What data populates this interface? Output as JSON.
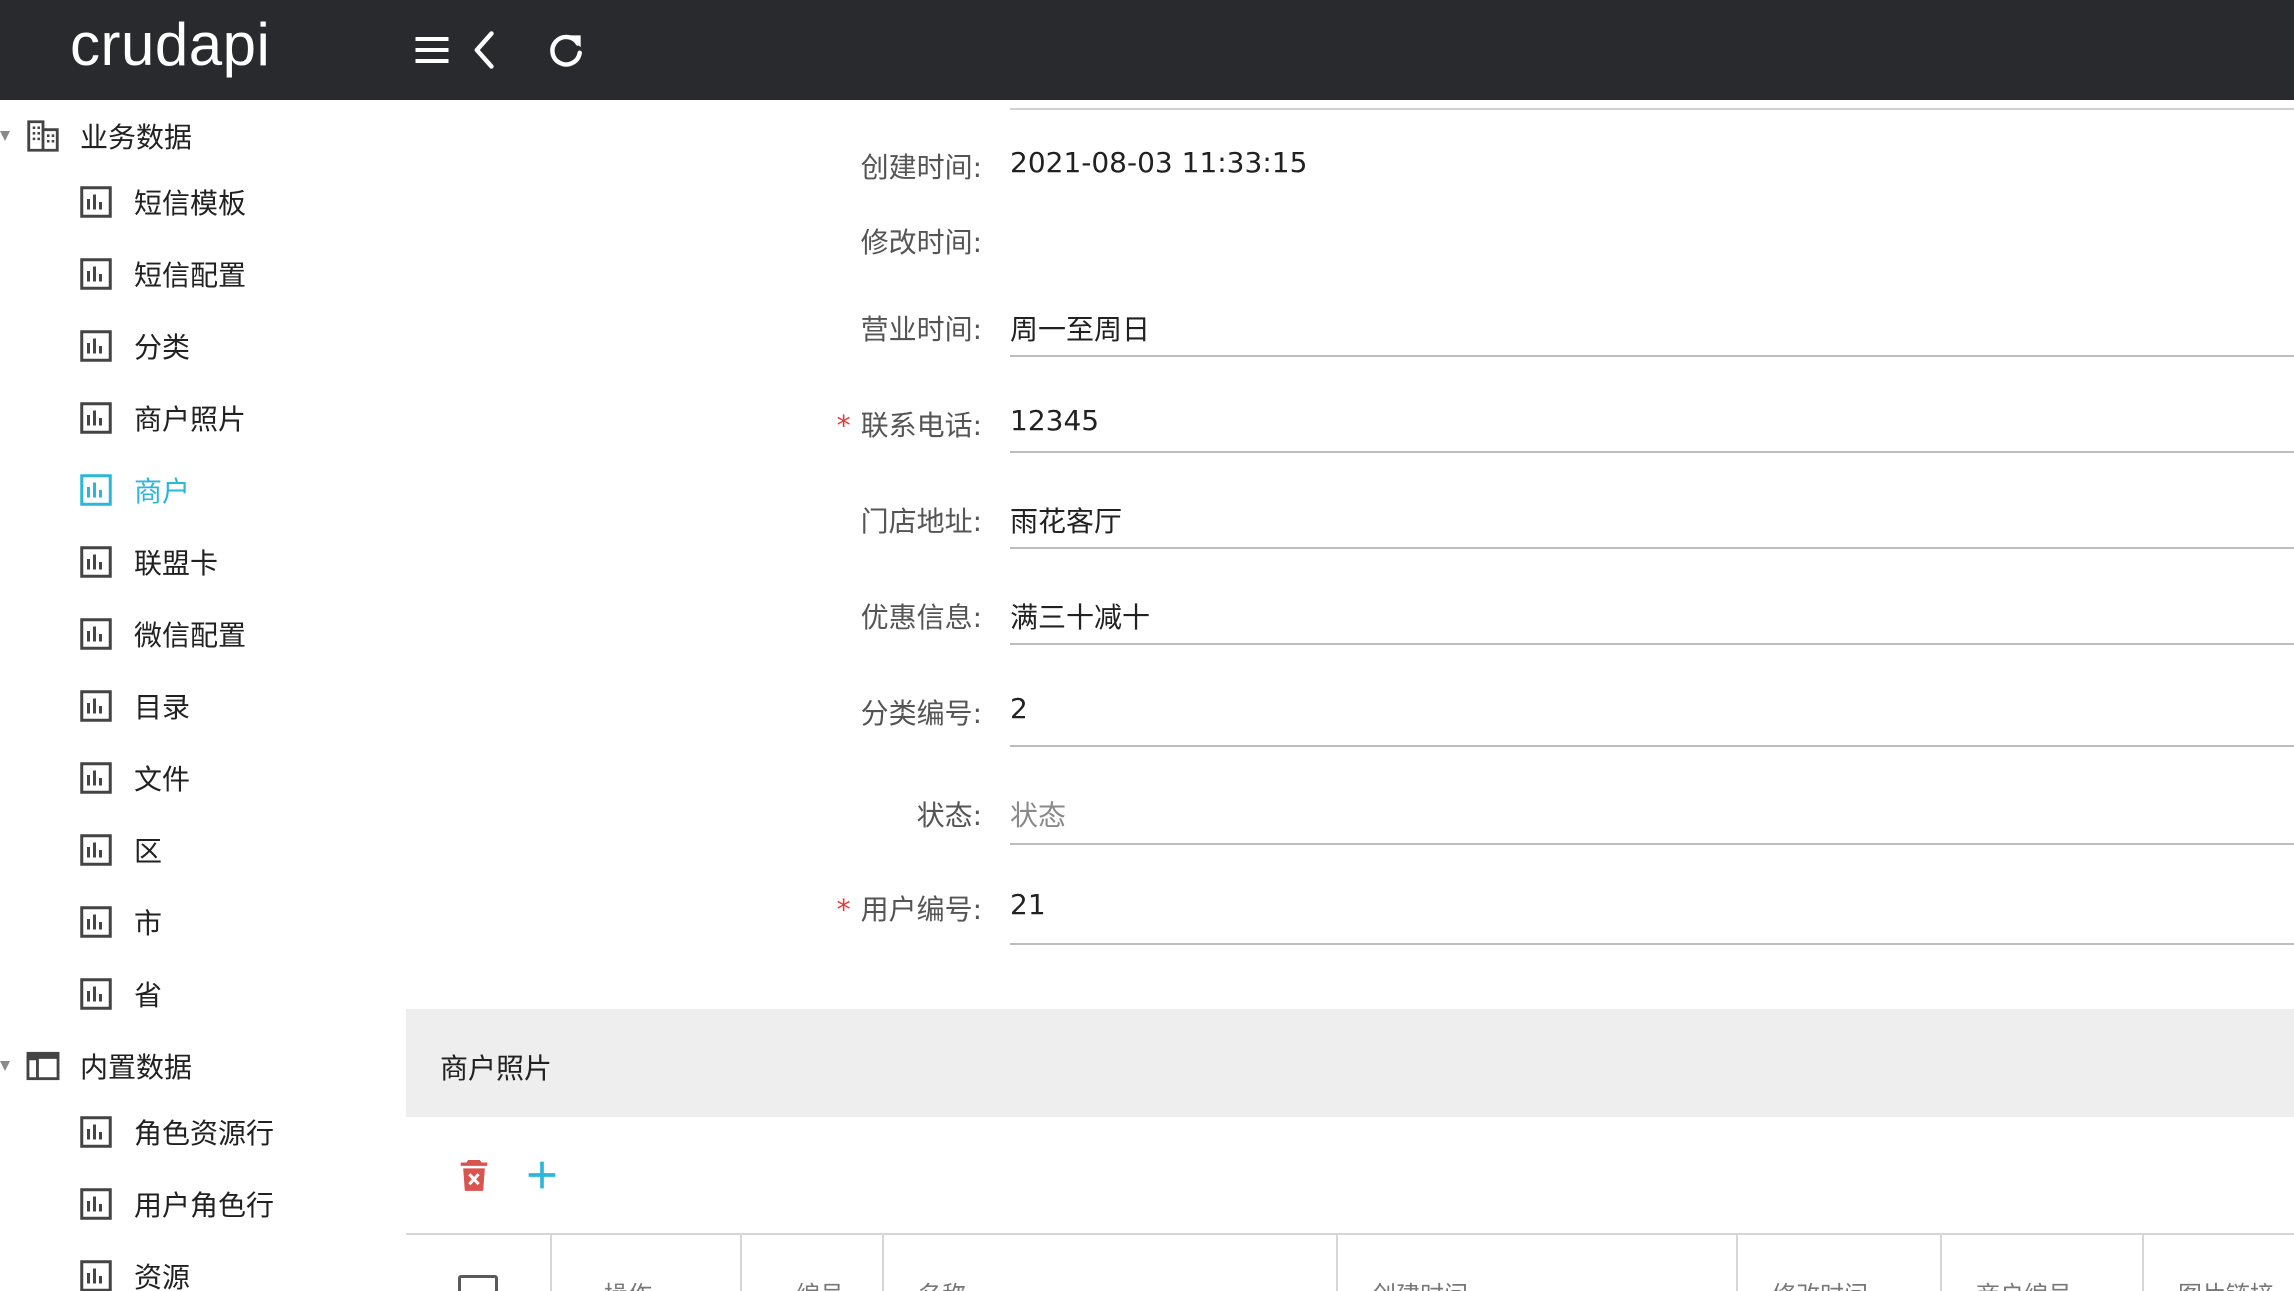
{
  "app": {
    "brand": "crudapi"
  },
  "header": {
    "icons": [
      "menu-icon",
      "back-icon",
      "refresh-icon"
    ]
  },
  "sidebar": {
    "groups": [
      {
        "label": "业务数据",
        "icon": "building-icon",
        "items": [
          {
            "label": "短信模板"
          },
          {
            "label": "短信配置"
          },
          {
            "label": "分类"
          },
          {
            "label": "商户照片"
          },
          {
            "label": "商户",
            "active": true
          },
          {
            "label": "联盟卡"
          },
          {
            "label": "微信配置"
          },
          {
            "label": "目录"
          },
          {
            "label": "文件"
          },
          {
            "label": "区"
          },
          {
            "label": "市"
          },
          {
            "label": "省"
          }
        ]
      },
      {
        "label": "内置数据",
        "icon": "window-icon",
        "items": [
          {
            "label": "角色资源行"
          },
          {
            "label": "用户角色行"
          },
          {
            "label": "资源"
          }
        ]
      }
    ],
    "active_color": "#2bb7d9"
  },
  "form": {
    "fields": [
      {
        "label": "创建时间:",
        "value": "2021-08-03 11:33:15",
        "required": false,
        "underline": false
      },
      {
        "label": "修改时间:",
        "value": "",
        "required": false,
        "underline": false
      },
      {
        "label": "营业时间:",
        "value": "周一至周日",
        "required": false,
        "underline": true
      },
      {
        "label": "联系电话:",
        "value": "12345",
        "required": true,
        "underline": true
      },
      {
        "label": "门店地址:",
        "value": "雨花客厅",
        "required": false,
        "underline": true
      },
      {
        "label": "优惠信息:",
        "value": "满三十减十",
        "required": false,
        "underline": true
      },
      {
        "label": "分类编号:",
        "value": "2",
        "required": false,
        "underline": true
      },
      {
        "label": "状态:",
        "value": "",
        "placeholder": "状态",
        "required": false,
        "underline": true
      },
      {
        "label": "用户编号:",
        "value": "21",
        "required": true,
        "underline": true
      }
    ],
    "required_mark": "*"
  },
  "subtable": {
    "title": "商户照片",
    "toolbar": [
      "delete-icon",
      "add-icon"
    ],
    "columns": [
      "操作",
      "编号",
      "名称",
      "创建时间",
      "修改时间",
      "商户编号",
      "图片链接"
    ]
  }
}
